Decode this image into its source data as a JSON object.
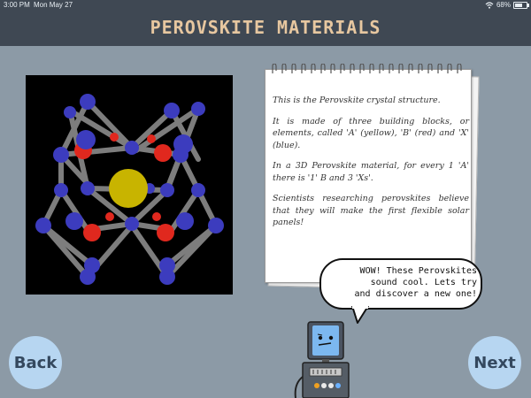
{
  "status_bar": {
    "time": "3:00 PM",
    "date": "Mon May 27",
    "battery": "68%",
    "battery_level": 0.68
  },
  "header": {
    "title": "PEROVSKITE MATERIALS"
  },
  "notebook": {
    "paragraphs": [
      "This is the Perovskite crystal structure.",
      "It is made of three building blocks, or elements, called 'A' (yellow), 'B' (red) and 'X' (blue).",
      "In a 3D Perovskite material, for every 1 'A' there is '1' B and 3 'Xs'.",
      "Scientists researching perovskites believe that they will make the first flexible solar panels!"
    ]
  },
  "speech_bubble": {
    "lines": [
      "WOW! These Perovskites",
      "sound cool. Lets try",
      "and discover a new one!"
    ]
  },
  "nav": {
    "back_label": "Back",
    "next_label": "Next"
  },
  "colors": {
    "bar": "#3f4853",
    "background": "#8c9aa6",
    "button": "#b7d6f1",
    "title": "#e7c7a0",
    "atom_a": "#c8b400",
    "atom_b": "#e0281e",
    "atom_x": "#3c3cbe"
  },
  "icons": {
    "wifi": "wifi-icon",
    "battery": "battery-icon"
  }
}
